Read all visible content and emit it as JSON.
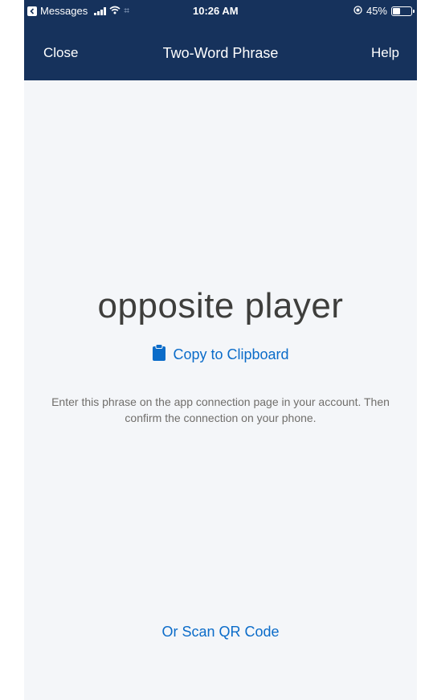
{
  "status_bar": {
    "carrier": "Messages",
    "time": "10:26 AM",
    "battery_text": "45%",
    "battery_level": 0.45
  },
  "nav": {
    "close_label": "Close",
    "title": "Two-Word Phrase",
    "help_label": "Help"
  },
  "content": {
    "phrase": "opposite player",
    "copy_label": "Copy to Clipboard",
    "description": "Enter this phrase on the app connection page in your account. Then confirm the connection on your phone.",
    "scan_label": "Or Scan QR Code"
  },
  "colors": {
    "header_bg": "#16325c",
    "link": "#0b6cc9",
    "body_bg": "#f4f6f9"
  },
  "icons": {
    "back": "back-to-app-icon",
    "signal": "signal-bars-icon",
    "wifi": "wifi-icon",
    "location": "location-icon",
    "battery": "battery-icon",
    "clipboard": "clipboard-icon"
  }
}
